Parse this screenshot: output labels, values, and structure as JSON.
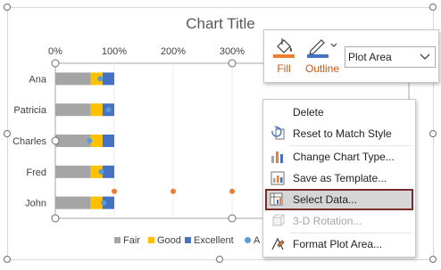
{
  "chart": {
    "title": "Chart Title"
  },
  "chart_data": {
    "type": "bar",
    "orientation": "horizontal",
    "stacked": true,
    "categories": [
      "John",
      "Fred",
      "Charles",
      "Patricia",
      "Ana"
    ],
    "xlim": [
      0,
      3
    ],
    "x_ticks": [
      "0%",
      "100%",
      "200%",
      "300%"
    ],
    "series": [
      {
        "name": "Fair",
        "color": "#a5a5a5",
        "values": [
          0.6,
          0.6,
          0.6,
          0.6,
          0.6
        ]
      },
      {
        "name": "Good",
        "color": "#ffc000",
        "values": [
          0.2,
          0.2,
          0.2,
          0.2,
          0.2
        ]
      },
      {
        "name": "Excellent",
        "color": "#4472c4",
        "values": [
          0.2,
          0.2,
          0.2,
          0.2,
          0.2
        ]
      }
    ],
    "marker_series": [
      {
        "name": "A",
        "color": "#5b9bd5",
        "points": [
          {
            "category": "John",
            "value": 0.82
          },
          {
            "category": "Fred",
            "value": 0.78
          },
          {
            "category": "Charles",
            "value": 0.58
          },
          {
            "category": "Patricia",
            "value": 0.9
          },
          {
            "category": "Ana",
            "value": 0.76
          }
        ]
      },
      {
        "color": "#ed7d31",
        "points": [
          {
            "value": 1.0
          },
          {
            "value": 2.0
          },
          {
            "value": 3.0
          }
        ]
      }
    ],
    "legend": {
      "position": "bottom",
      "entries": [
        "Fair",
        "Good",
        "Excellent",
        "A"
      ]
    },
    "grid": true
  },
  "format_toolbar": {
    "fill_label": "Fill",
    "outline_label": "Outline",
    "element_select_value": "Plot Area",
    "icons": [
      "paint-bucket-icon",
      "pen-outline-icon",
      "chevron-down-icon"
    ]
  },
  "context_menu": {
    "items": [
      {
        "label": "Delete",
        "icon": "",
        "disabled": false,
        "selected": false
      },
      {
        "label": "Reset to Match Style",
        "icon": "reset-style-icon",
        "disabled": false,
        "selected": false
      },
      {
        "label": "Change Chart Type...",
        "icon": "chart-type-icon",
        "disabled": false,
        "selected": false
      },
      {
        "label": "Save as Template...",
        "icon": "save-template-icon",
        "disabled": false,
        "selected": false
      },
      {
        "label": "Select Data...",
        "icon": "select-data-icon",
        "disabled": false,
        "selected": true
      },
      {
        "label": "3-D Rotation...",
        "icon": "rotation-3d-icon",
        "disabled": true,
        "selected": false
      },
      {
        "label": "Format Plot Area...",
        "icon": "format-area-icon",
        "disabled": false,
        "selected": false
      }
    ]
  },
  "colors": {
    "accent": "#c55a11",
    "selected_border": "#7a2a2a"
  }
}
